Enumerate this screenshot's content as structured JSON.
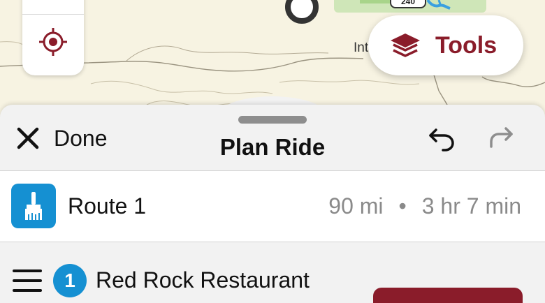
{
  "map": {
    "label": "Int",
    "route_shield": "240",
    "tools_label": "Tools",
    "colors": {
      "brand": "#8a1c2a",
      "terrain": "#f7f3e2",
      "park": "#cfe6b8"
    }
  },
  "sheet": {
    "done_label": "Done",
    "title": "Plan Ride"
  },
  "route": {
    "name": "Route 1",
    "distance": "90 mi",
    "separator": "•",
    "duration": "3 hr 7 min",
    "icon": "paintbrush-icon",
    "accent": "#1590d2"
  },
  "stops": [
    {
      "number": "1",
      "name": "Red Rock Restaurant"
    }
  ]
}
